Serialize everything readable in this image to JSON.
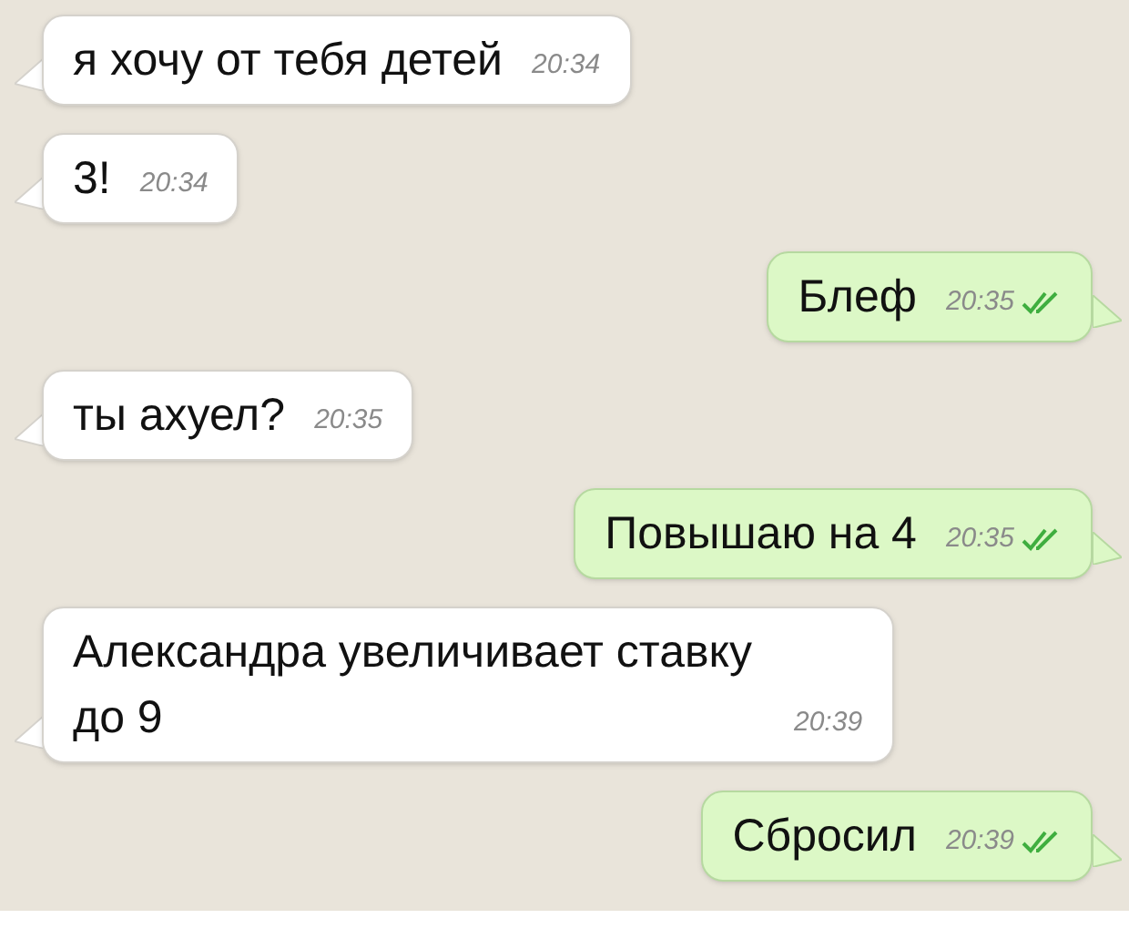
{
  "messages": [
    {
      "kind": "incoming",
      "text": "я хочу от тебя детей",
      "time": "20:34"
    },
    {
      "kind": "incoming",
      "text": "3!",
      "time": "20:34"
    },
    {
      "kind": "outgoing",
      "text": "Блеф",
      "time": "20:35",
      "read": true
    },
    {
      "kind": "incoming",
      "text": "ты ахуел?",
      "time": "20:35"
    },
    {
      "kind": "outgoing",
      "text": "Повышаю на 4",
      "time": "20:35",
      "read": true
    },
    {
      "kind": "incoming",
      "text": "Александра увеличивает ставку до 9",
      "time": "20:39"
    },
    {
      "kind": "outgoing",
      "text": "Сбросил",
      "time": "20:39",
      "read": true
    }
  ]
}
